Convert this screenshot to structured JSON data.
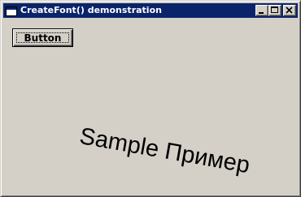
{
  "window": {
    "title": "CreateFont() demonstration",
    "controls": {
      "minimize_icon": "minimize-icon",
      "maximize_icon": "maximize-icon",
      "close_icon": "close-icon"
    },
    "title_bar_color": "#0a246a",
    "face_color": "#d4d0c8"
  },
  "client": {
    "button_label": "Button",
    "sample_text": "Sample Пример"
  }
}
